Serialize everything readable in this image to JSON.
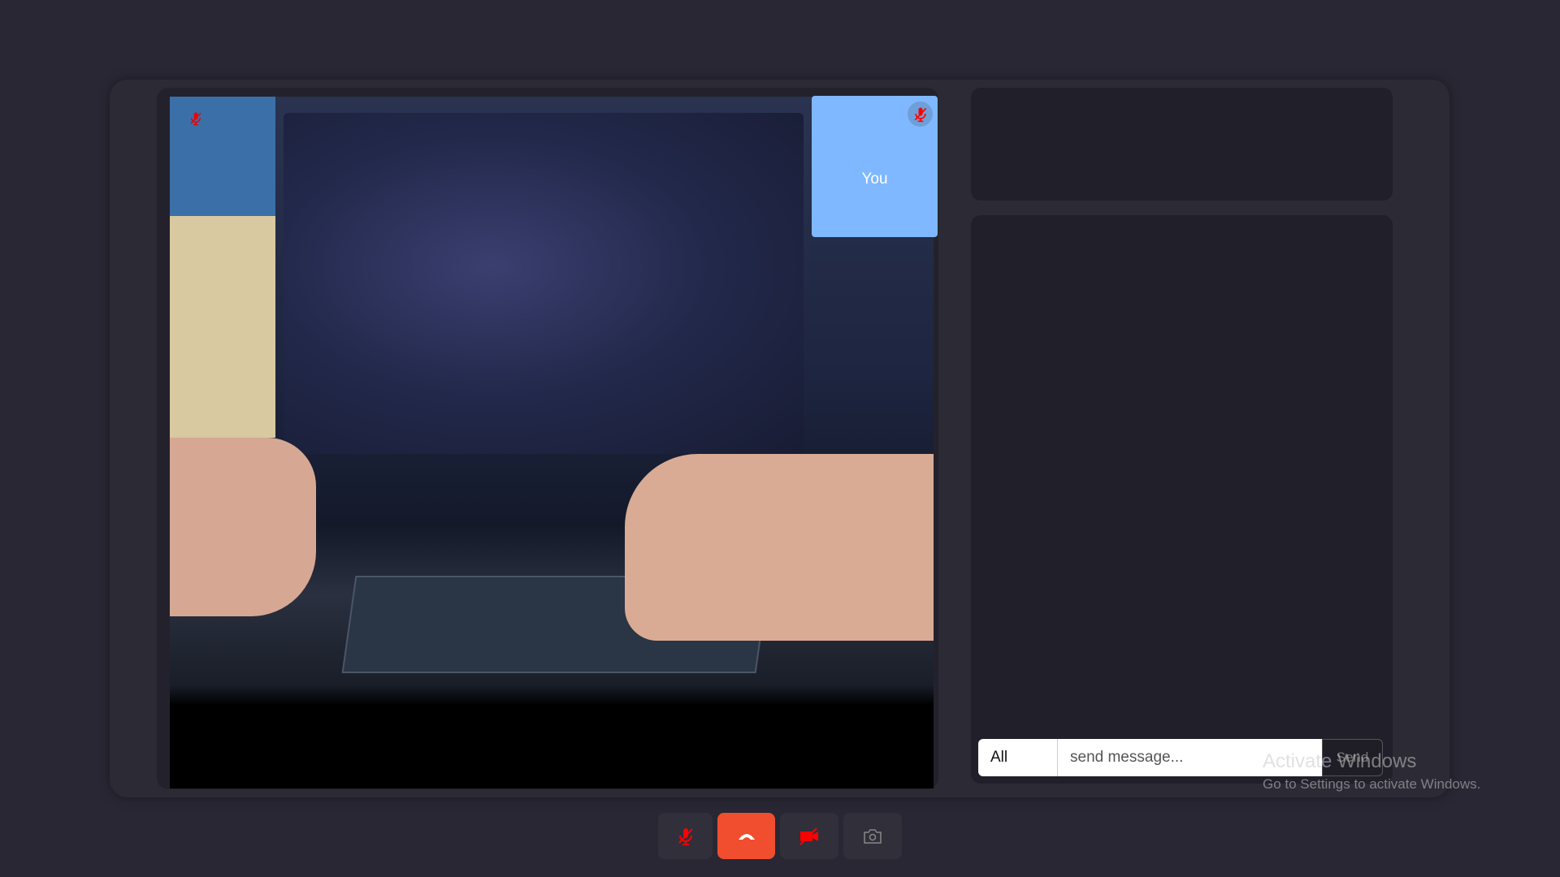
{
  "remote_video": {
    "muted": true,
    "icon": "mic-off-icon"
  },
  "self_tile": {
    "label": "You",
    "bg_color": "#7fb8fe",
    "muted": true
  },
  "chat": {
    "recipient": "All",
    "message_value": "",
    "message_placeholder": "send message...",
    "send_label": "Send"
  },
  "controls": [
    {
      "name": "mic-toggle",
      "icon": "mic-off-icon",
      "state": "off"
    },
    {
      "name": "hang-up",
      "icon": "phone-hangup-icon",
      "color": "#f04e2e"
    },
    {
      "name": "camera-toggle",
      "icon": "video-off-icon",
      "state": "off"
    },
    {
      "name": "switch-camera",
      "icon": "camera-flip-icon"
    }
  ],
  "watermark": {
    "title": "Activate Windows",
    "subtitle": "Go to Settings to activate Windows."
  }
}
